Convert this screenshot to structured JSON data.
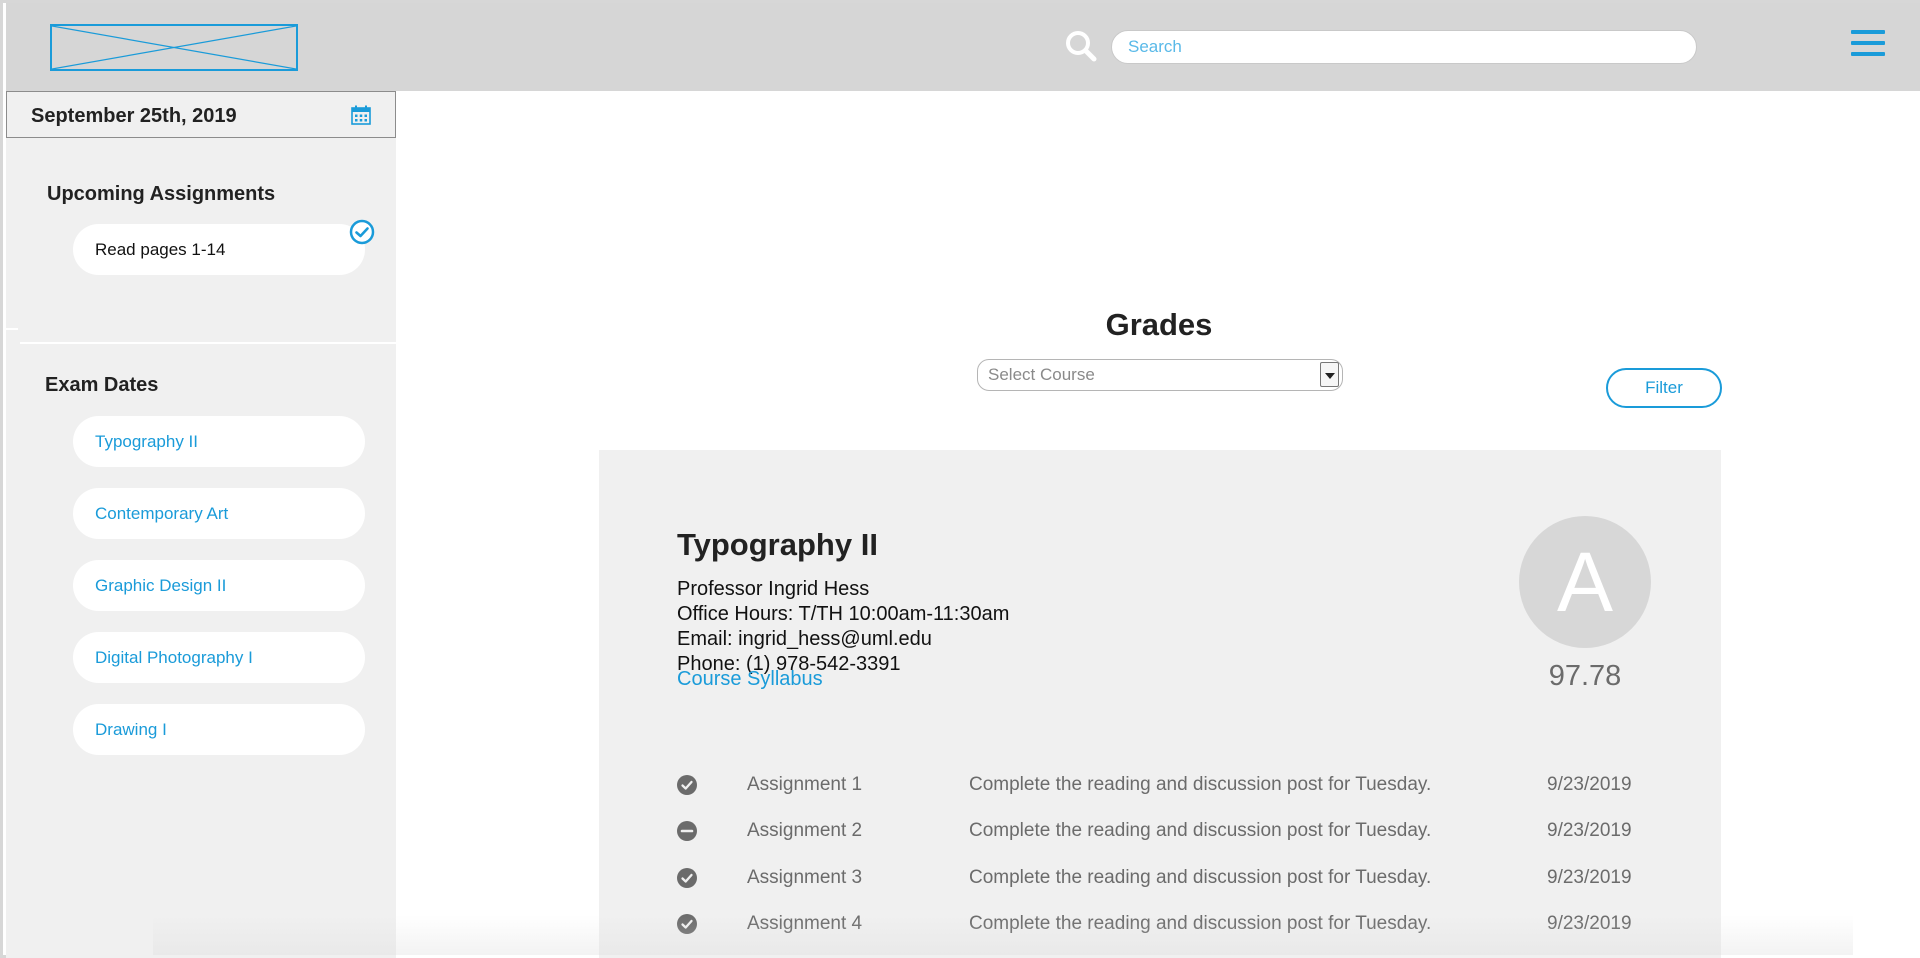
{
  "header": {
    "search_placeholder": "Search"
  },
  "sidebar": {
    "date": "September 25th, 2019",
    "upcoming_title": "Upcoming Assignments",
    "upcoming_items": [
      {
        "label": "Read pages 1-14"
      }
    ],
    "exam_title": "Exam Dates",
    "exam_items": [
      {
        "label": "Typography II"
      },
      {
        "label": "Contemporary Art"
      },
      {
        "label": "Graphic Design II"
      },
      {
        "label": "Digital Photography I"
      },
      {
        "label": "Drawing I"
      }
    ]
  },
  "main": {
    "title": "Grades",
    "select_placeholder": "Select Course",
    "filter_label": "Filter",
    "course": {
      "name": "Typography II",
      "professor": "Professor Ingrid Hess",
      "office_hours": "Office Hours: T/TH 10:00am-11:30am",
      "email": "Email: ingrid_hess@uml.edu",
      "phone": "Phone: (1) 978-542-3391",
      "syllabus_link": "Course Syllabus",
      "letter_grade": "A",
      "score": "97.78"
    },
    "assignments": [
      {
        "status": "complete",
        "name": "Assignment 1",
        "description": "Complete the reading and discussion post for Tuesday.",
        "date": "9/23/2019"
      },
      {
        "status": "missing",
        "name": "Assignment 2",
        "description": "Complete the reading and discussion post for Tuesday.",
        "date": "9/23/2019"
      },
      {
        "status": "complete",
        "name": "Assignment 3",
        "description": "Complete the reading and discussion post for Tuesday.",
        "date": "9/23/2019"
      },
      {
        "status": "complete",
        "name": "Assignment 4",
        "description": "Complete the reading and discussion post for Tuesday.",
        "date": "9/23/2019"
      }
    ]
  },
  "colors": {
    "accent": "#1a9bd9",
    "header_bg": "#d6d6d6",
    "sidebar_bg": "#f0f0f0",
    "card_bg": "#f0f0f0",
    "grade_circle": "#d7d7d7",
    "muted_text": "#6b6b6b"
  }
}
